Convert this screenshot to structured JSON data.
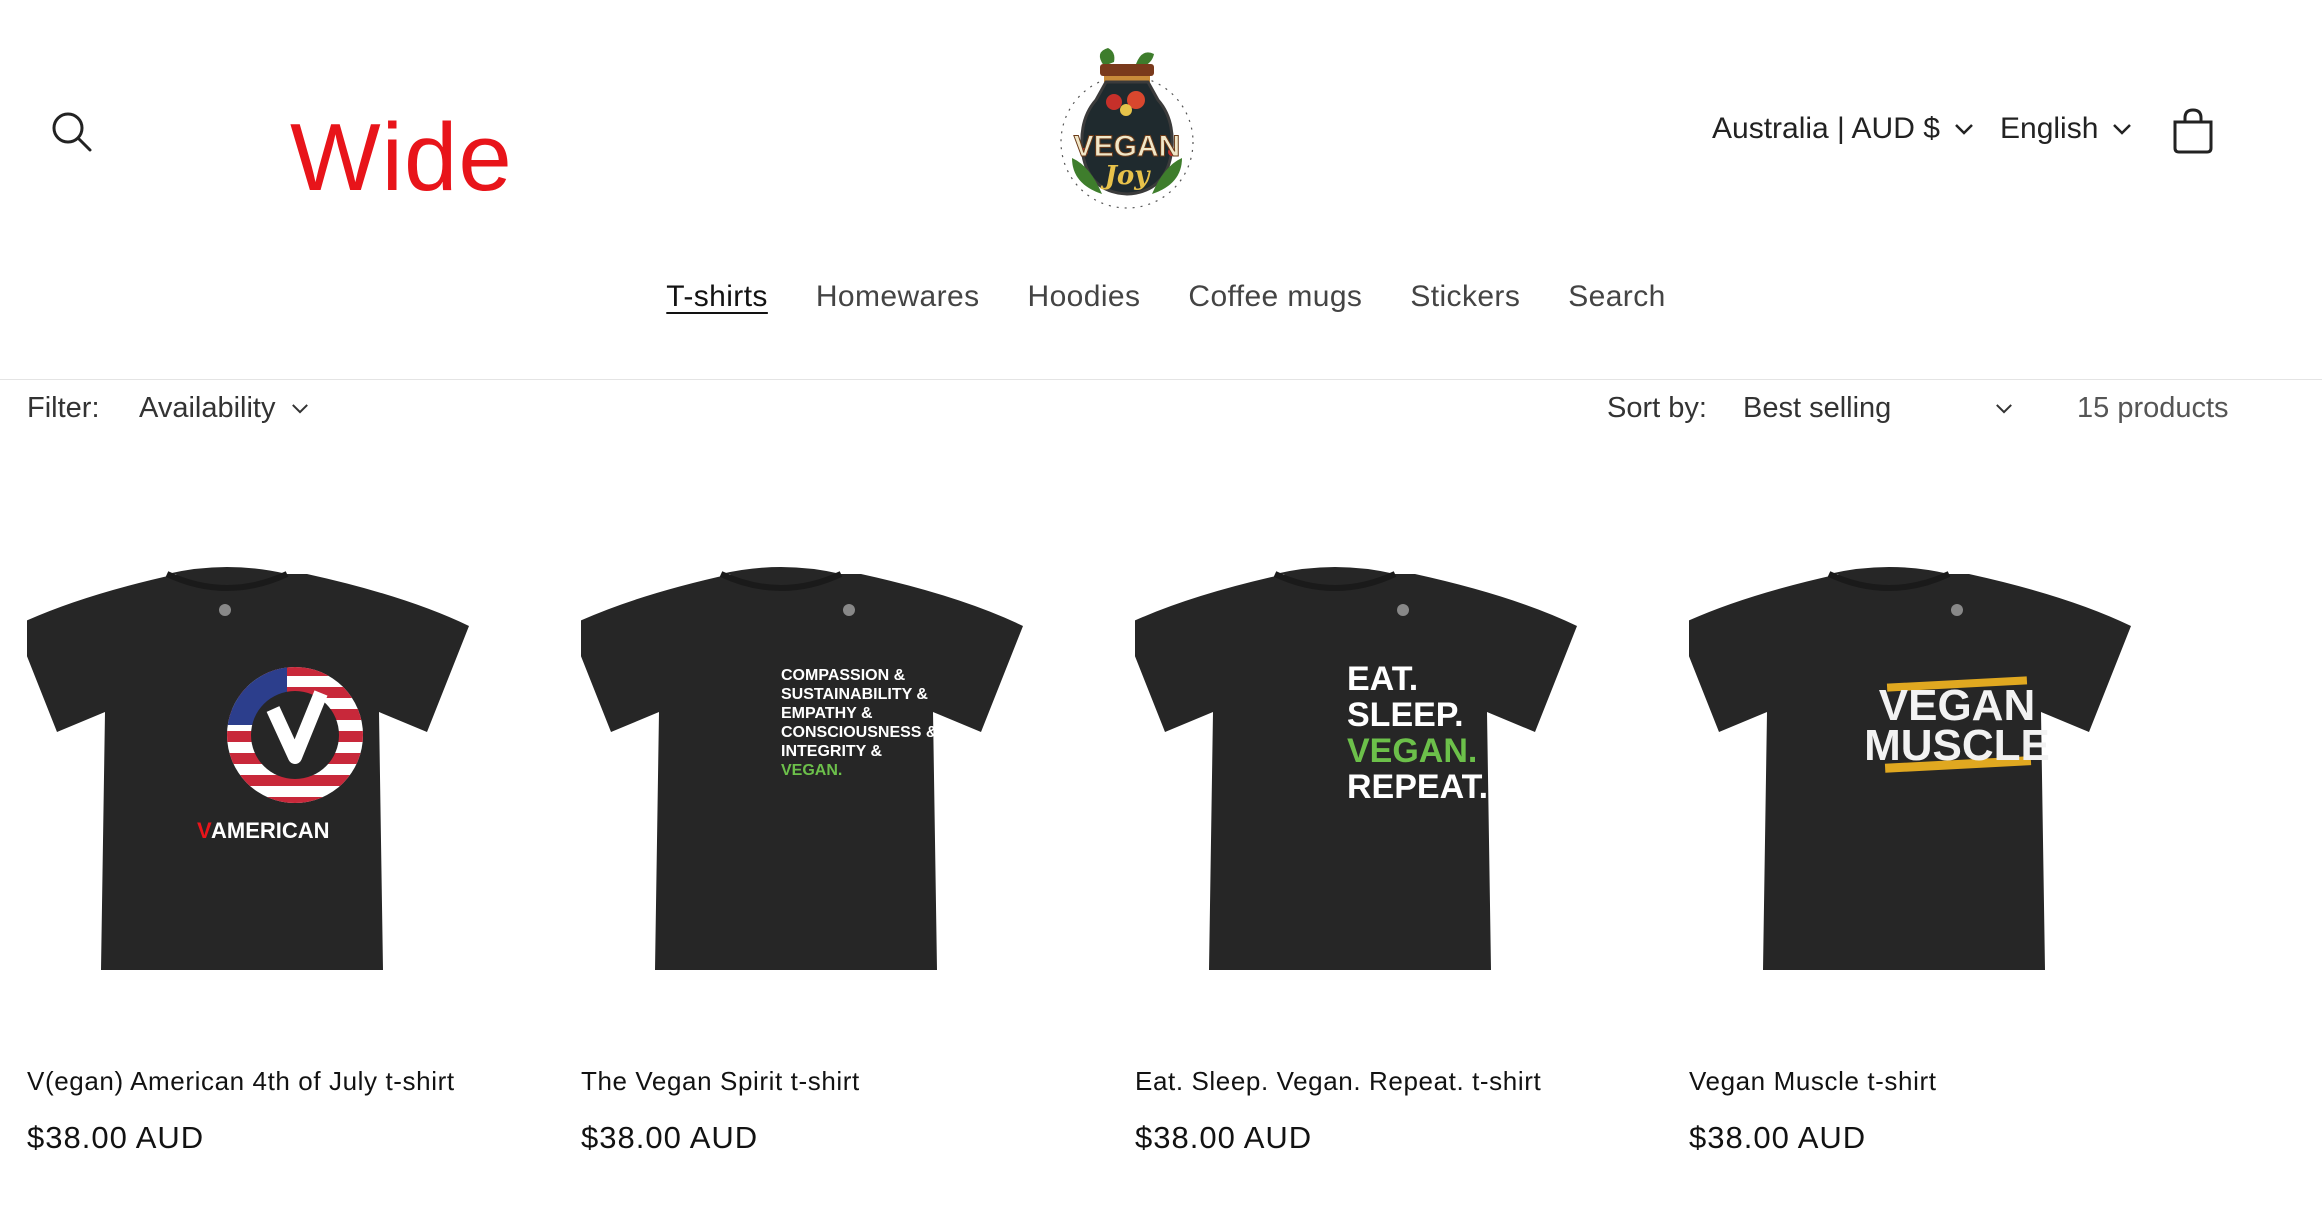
{
  "header": {
    "overlay_text": "Wide",
    "logo": {
      "line1": "VEGAN",
      "line2": "Joy"
    },
    "country_selector": "Australia | AUD $",
    "language_selector": "English",
    "icons": {
      "search": "search-icon",
      "cart": "cart-icon",
      "chevron": "chevron-down-icon"
    }
  },
  "nav": {
    "items": [
      "T-shirts",
      "Homewares",
      "Hoodies",
      "Coffee mugs",
      "Stickers",
      "Search"
    ],
    "active": "T-shirts"
  },
  "filters": {
    "filter_label": "Filter:",
    "availability_label": "Availability",
    "sort_label": "Sort by:",
    "sort_value": "Best selling",
    "product_count": "15 products"
  },
  "products": [
    {
      "title": "V(egan) American 4th of July t-shirt",
      "price": "$38.00 AUD",
      "print": {
        "prefix": "V",
        "text": "AMERICAN"
      }
    },
    {
      "title": "The Vegan Spirit t-shirt",
      "price": "$38.00 AUD",
      "print": {
        "lines": [
          "COMPASSION &",
          "SUSTAINABILITY &",
          "EMPATHY &",
          "CONSCIOUSNESS &",
          "INTEGRITY &",
          "VEGAN."
        ]
      }
    },
    {
      "title": "Eat. Sleep. Vegan. Repeat. t-shirt",
      "price": "$38.00 AUD",
      "print": {
        "lines": [
          "EAT.",
          "SLEEP.",
          "VEGAN.",
          "REPEAT."
        ]
      }
    },
    {
      "title": "Vegan Muscle t-shirt",
      "price": "$38.00 AUD",
      "print": {
        "lines": [
          "VEGAN",
          "MUSCLE"
        ]
      }
    }
  ],
  "colors": {
    "accent_red": "#e8141a",
    "shirt": "#262626",
    "vegan_green": "#6cc04a",
    "muscle_gold": "#e0a820"
  }
}
